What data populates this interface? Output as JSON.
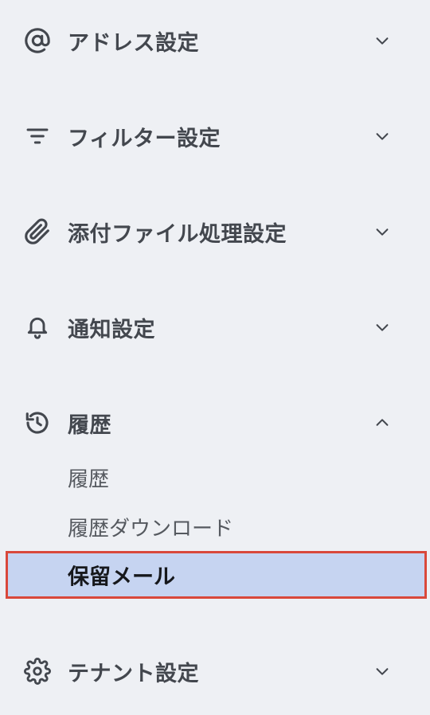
{
  "menu": {
    "address": {
      "label": "アドレス設定",
      "icon": "at-sign-icon",
      "expanded": false
    },
    "filter": {
      "label": "フィルター設定",
      "icon": "filter-icon",
      "expanded": false
    },
    "attachment": {
      "label": "添付ファイル処理設定",
      "icon": "paperclip-icon",
      "expanded": false
    },
    "notification": {
      "label": "通知設定",
      "icon": "bell-icon",
      "expanded": false
    },
    "history": {
      "label": "履歴",
      "icon": "history-icon",
      "expanded": true,
      "items": [
        {
          "label": "履歴",
          "active": false
        },
        {
          "label": "履歴ダウンロード",
          "active": false
        },
        {
          "label": "保留メール",
          "active": true
        }
      ]
    },
    "tenant": {
      "label": "テナント設定",
      "icon": "gear-icon",
      "expanded": false
    }
  },
  "colors": {
    "background": "#eef0f4",
    "active_background": "#c6d4f1",
    "highlight_border": "#d9483b",
    "text": "#43474e"
  }
}
